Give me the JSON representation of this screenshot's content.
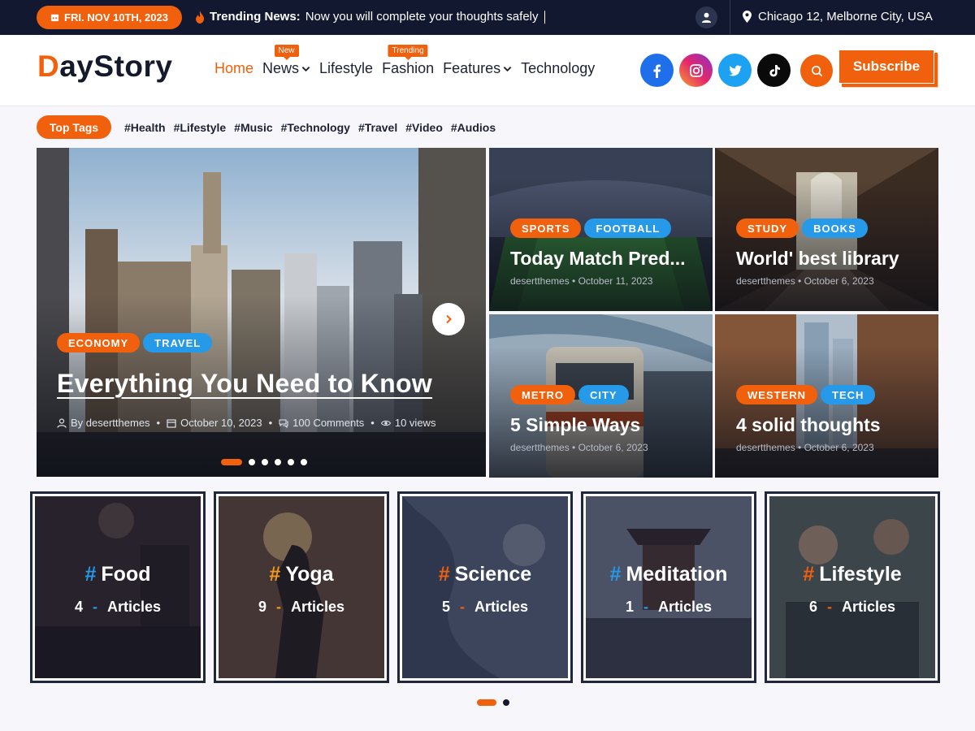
{
  "topbar": {
    "date": "FRI. NOV 10TH, 2023",
    "trending_label": "Trending News:",
    "trending_text": "Now you will complete your thoughts safely",
    "location": "Chicago 12, Melborne City, USA"
  },
  "header": {
    "logo_first": "D",
    "logo_rest": "ayStory",
    "nav": [
      {
        "label": "Home",
        "badge": ""
      },
      {
        "label": "News",
        "badge": "New"
      },
      {
        "label": "Lifestyle",
        "badge": ""
      },
      {
        "label": "Fashion",
        "badge": "Trending"
      },
      {
        "label": "Features",
        "badge": ""
      },
      {
        "label": "Technology",
        "badge": ""
      }
    ],
    "subscribe": "Subscribe"
  },
  "tags": {
    "label": "Top Tags",
    "items": [
      "#Health",
      "#Lifestyle",
      "#Music",
      "#Technology",
      "#Travel",
      "#Video",
      "#Audios"
    ]
  },
  "hero": {
    "chips": [
      "ECONOMY",
      "TRAVEL"
    ],
    "title": "Everything You Need to Know",
    "author": "By desertthemes",
    "date": "October 10, 2023",
    "comments": "100 Comments",
    "views": "10 views"
  },
  "cards": [
    {
      "chips": [
        "SPORTS",
        "FOOTBALL"
      ],
      "title": "Today Match Pred...",
      "author": "desertthemes",
      "date": "October 11, 2023"
    },
    {
      "chips": [
        "STUDY",
        "BOOKS"
      ],
      "title": "World' best library",
      "author": "desertthemes",
      "date": "October 6, 2023"
    },
    {
      "chips": [
        "METRO",
        "CITY"
      ],
      "title": "5 Simple Ways",
      "author": "desertthemes",
      "date": "October 6, 2023"
    },
    {
      "chips": [
        "WESTERN",
        "TECH"
      ],
      "title": "4 solid thoughts",
      "author": "desertthemes",
      "date": "October 6, 2023"
    }
  ],
  "categories": [
    {
      "name": "Food",
      "count": "4",
      "articles": "Articles",
      "hash_color": "#2699e8"
    },
    {
      "name": "Yoga",
      "count": "9",
      "articles": "Articles",
      "hash_color": "#f39a1e"
    },
    {
      "name": "Science",
      "count": "5",
      "articles": "Articles",
      "hash_color": "#f1600d"
    },
    {
      "name": "Meditation",
      "count": "1",
      "articles": "Articles",
      "hash_color": "#2699e8"
    },
    {
      "name": "Lifestyle",
      "count": "6",
      "articles": "Articles",
      "hash_color": "#f1600d"
    }
  ],
  "colors": {
    "accent": "#f1600d",
    "blue": "#2699e8",
    "dark": "#111830"
  }
}
